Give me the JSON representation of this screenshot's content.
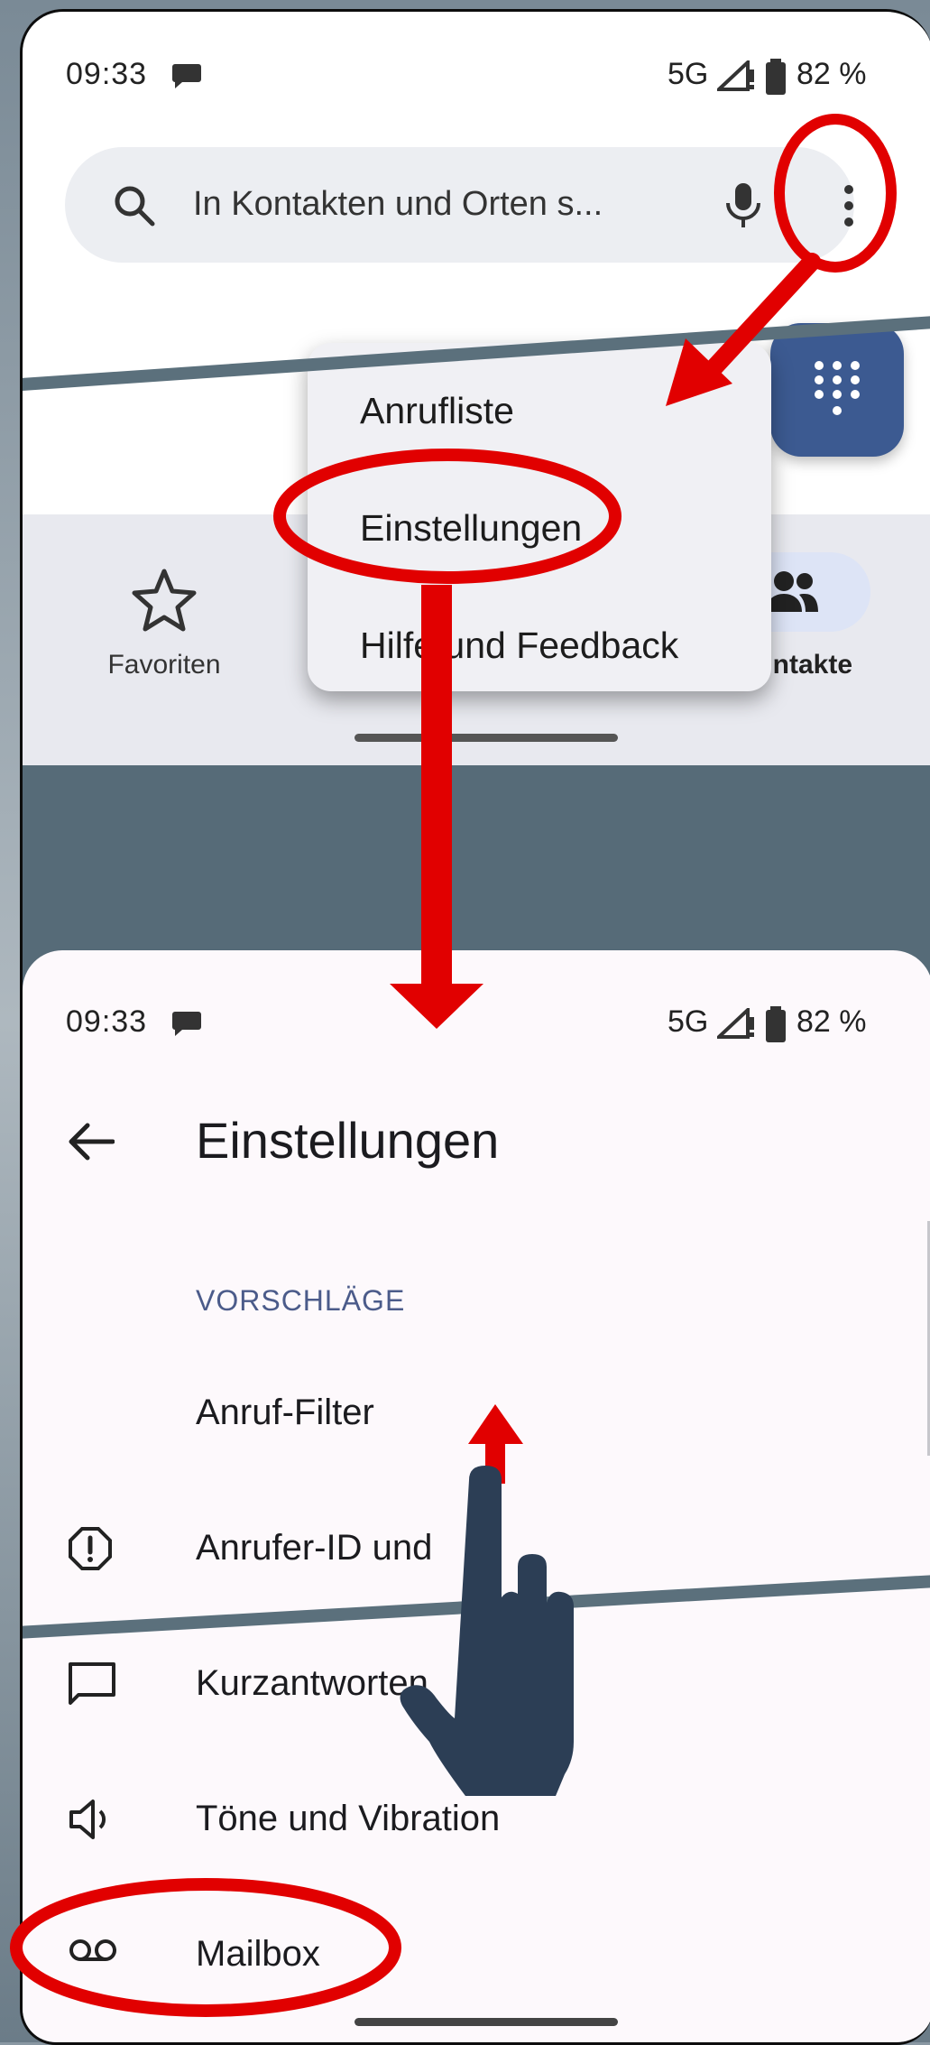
{
  "status_bar": {
    "time": "09:33",
    "network": "5G",
    "battery": "82 %"
  },
  "search": {
    "placeholder": "In Kontakten und Orten s..."
  },
  "overflow_menu": {
    "items": [
      {
        "label": "Anrufliste"
      },
      {
        "label": "Einstellungen"
      },
      {
        "label": "Hilfe und Feedback"
      }
    ]
  },
  "bottom_nav": {
    "favorites_label": "Favoriten",
    "contacts_label": "Kontakte",
    "contacts_label_visible": "ntakte"
  },
  "settings": {
    "title": "Einstellungen",
    "section_header": "VORSCHLÄGE",
    "items": [
      {
        "label": "Anruf-Filter",
        "icon": "none"
      },
      {
        "label": "Anrufer-ID und Spam",
        "visible_label": "Anrufer-ID und",
        "icon": "alert-octagon-icon"
      },
      {
        "label": "Kurzantworten",
        "icon": "message-bubble-icon"
      },
      {
        "label": "Töne und Vibration",
        "icon": "speaker-icon"
      },
      {
        "label": "Mailbox",
        "icon": "voicemail-icon"
      }
    ]
  },
  "colors": {
    "accent_red": "#e10000",
    "fab": "#3c5a91",
    "section": "#4b5b8a"
  }
}
